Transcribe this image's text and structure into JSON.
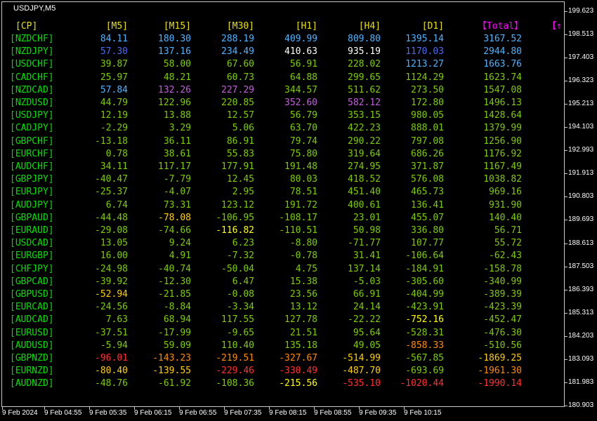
{
  "chart": {
    "symbol": "USDJPY,M5"
  },
  "colors": {
    "header": "#e8e000",
    "total_header": "#ff00ff",
    "pair": "#00e000"
  },
  "table": {
    "headers": [
      "[CP]",
      "[M5]",
      "[M15]",
      "[M30]",
      "[H1]",
      "[H4]",
      "[D1]",
      "【Total】",
      "【↑"
    ],
    "rows": [
      {
        "pair": "[NZDCHF]",
        "values": [
          "84.11",
          "180.30",
          "288.19",
          "409.99",
          "809.80",
          "1395.14",
          "3167.52"
        ],
        "colors": [
          "#4fb4ff",
          "#4fb4ff",
          "#4fb4ff",
          "#4fb4ff",
          "#4fb4ff",
          "#4fb4ff",
          "#4fb4ff"
        ]
      },
      {
        "pair": "[NZDJPY]",
        "values": [
          "57.30",
          "137.16",
          "234.49",
          "410.63",
          "935.19",
          "1170.03",
          "2944.80"
        ],
        "colors": [
          "#4a6cf0",
          "#4fb4ff",
          "#4fb4ff",
          "#ffffff",
          "#ffffff",
          "#4a6cf0",
          "#4fb4ff"
        ]
      },
      {
        "pair": "[USDCHF]",
        "values": [
          "39.87",
          "58.00",
          "67.60",
          "56.91",
          "228.02",
          "1213.27",
          "1663.76"
        ],
        "colors": [
          "#7fcc00",
          "#7fcc00",
          "#7fcc00",
          "#7fcc00",
          "#7fcc00",
          "#4fb4ff",
          "#4fb4ff"
        ]
      },
      {
        "pair": "[CADCHF]",
        "values": [
          "25.97",
          "48.21",
          "60.73",
          "64.88",
          "299.65",
          "1124.29",
          "1623.74"
        ],
        "colors": [
          "#7fcc00",
          "#7fcc00",
          "#7fcc00",
          "#7fcc00",
          "#7fcc00",
          "#7fcc00",
          "#7fcc00"
        ]
      },
      {
        "pair": "[NZDCAD]",
        "values": [
          "57.84",
          "132.26",
          "227.29",
          "344.57",
          "511.62",
          "273.50",
          "1547.08"
        ],
        "colors": [
          "#4fb4ff",
          "#c060d8",
          "#c060d8",
          "#7fcc00",
          "#7fcc00",
          "#7fcc00",
          "#7fcc00"
        ]
      },
      {
        "pair": "[NZDUSD]",
        "values": [
          "44.79",
          "122.96",
          "220.85",
          "352.60",
          "582.12",
          "172.80",
          "1496.13"
        ],
        "colors": [
          "#7fcc00",
          "#7fcc00",
          "#7fcc00",
          "#c060d8",
          "#c060d8",
          "#7fcc00",
          "#7fcc00"
        ]
      },
      {
        "pair": "[USDJPY]",
        "values": [
          "12.19",
          "13.88",
          "12.57",
          "56.79",
          "353.15",
          "980.05",
          "1428.64"
        ],
        "colors": [
          "#7fcc00",
          "#7fcc00",
          "#7fcc00",
          "#7fcc00",
          "#7fcc00",
          "#7fcc00",
          "#7fcc00"
        ]
      },
      {
        "pair": "[CADJPY]",
        "values": [
          "-2.29",
          "3.29",
          "5.06",
          "63.70",
          "422.23",
          "888.01",
          "1379.99"
        ],
        "colors": [
          "#7fcc00",
          "#7fcc00",
          "#7fcc00",
          "#7fcc00",
          "#7fcc00",
          "#7fcc00",
          "#7fcc00"
        ]
      },
      {
        "pair": "[GBPCHF]",
        "values": [
          "-13.18",
          "36.11",
          "86.91",
          "79.74",
          "290.22",
          "797.08",
          "1256.90"
        ],
        "colors": [
          "#7fcc00",
          "#7fcc00",
          "#7fcc00",
          "#7fcc00",
          "#7fcc00",
          "#7fcc00",
          "#7fcc00"
        ]
      },
      {
        "pair": "[EURCHF]",
        "values": [
          "0.78",
          "38.61",
          "55.83",
          "75.80",
          "319.64",
          "686.26",
          "1176.92"
        ],
        "colors": [
          "#7fcc00",
          "#7fcc00",
          "#7fcc00",
          "#7fcc00",
          "#7fcc00",
          "#7fcc00",
          "#7fcc00"
        ]
      },
      {
        "pair": "[AUDCHF]",
        "values": [
          "34.11",
          "117.17",
          "177.91",
          "191.48",
          "274.95",
          "371.87",
          "1167.49"
        ],
        "colors": [
          "#7fcc00",
          "#7fcc00",
          "#7fcc00",
          "#7fcc00",
          "#7fcc00",
          "#7fcc00",
          "#7fcc00"
        ]
      },
      {
        "pair": "[GBPJPY]",
        "values": [
          "-40.47",
          "-7.79",
          "12.45",
          "80.03",
          "418.52",
          "576.08",
          "1038.82"
        ],
        "colors": [
          "#7fcc00",
          "#7fcc00",
          "#7fcc00",
          "#7fcc00",
          "#7fcc00",
          "#7fcc00",
          "#7fcc00"
        ]
      },
      {
        "pair": "[EURJPY]",
        "values": [
          "-25.37",
          "-4.07",
          "2.95",
          "78.51",
          "451.40",
          "465.73",
          "969.16"
        ],
        "colors": [
          "#7fcc00",
          "#7fcc00",
          "#7fcc00",
          "#7fcc00",
          "#7fcc00",
          "#7fcc00",
          "#7fcc00"
        ]
      },
      {
        "pair": "[AUDJPY]",
        "values": [
          "6.74",
          "73.31",
          "123.12",
          "191.72",
          "400.61",
          "136.41",
          "931.90"
        ],
        "colors": [
          "#7fcc00",
          "#7fcc00",
          "#7fcc00",
          "#7fcc00",
          "#7fcc00",
          "#7fcc00",
          "#7fcc00"
        ]
      },
      {
        "pair": "[GBPAUD]",
        "values": [
          "-44.48",
          "-78.08",
          "-106.95",
          "-108.17",
          "23.01",
          "455.07",
          "140.40"
        ],
        "colors": [
          "#7fcc00",
          "#ffd000",
          "#7fcc00",
          "#7fcc00",
          "#7fcc00",
          "#7fcc00",
          "#7fcc00"
        ]
      },
      {
        "pair": "[EURAUD]",
        "values": [
          "-29.08",
          "-74.66",
          "-116.82",
          "-110.51",
          "50.98",
          "336.80",
          "56.71"
        ],
        "colors": [
          "#7fcc00",
          "#7fcc00",
          "#ffff00",
          "#7fcc00",
          "#7fcc00",
          "#7fcc00",
          "#7fcc00"
        ]
      },
      {
        "pair": "[USDCAD]",
        "values": [
          "13.05",
          "9.24",
          "6.23",
          "-8.80",
          "-71.77",
          "107.77",
          "55.72"
        ],
        "colors": [
          "#7fcc00",
          "#7fcc00",
          "#7fcc00",
          "#7fcc00",
          "#7fcc00",
          "#7fcc00",
          "#7fcc00"
        ]
      },
      {
        "pair": "[EURGBP]",
        "values": [
          "16.00",
          "4.91",
          "-7.32",
          "-0.78",
          "31.41",
          "-106.64",
          "-62.43"
        ],
        "colors": [
          "#7fcc00",
          "#7fcc00",
          "#7fcc00",
          "#7fcc00",
          "#7fcc00",
          "#7fcc00",
          "#7fcc00"
        ]
      },
      {
        "pair": "[CHFJPY]",
        "values": [
          "-24.98",
          "-40.74",
          "-50.04",
          "4.75",
          "137.14",
          "-184.91",
          "-158.78"
        ],
        "colors": [
          "#7fcc00",
          "#7fcc00",
          "#7fcc00",
          "#7fcc00",
          "#7fcc00",
          "#7fcc00",
          "#7fcc00"
        ]
      },
      {
        "pair": "[GBPCAD]",
        "values": [
          "-39.92",
          "-12.30",
          "6.47",
          "15.38",
          "-5.03",
          "-305.60",
          "-340.99"
        ],
        "colors": [
          "#7fcc00",
          "#7fcc00",
          "#7fcc00",
          "#7fcc00",
          "#7fcc00",
          "#7fcc00",
          "#7fcc00"
        ]
      },
      {
        "pair": "[GBPUSD]",
        "values": [
          "-52.94",
          "-21.85",
          "-0.08",
          "23.56",
          "66.91",
          "-404.99",
          "-389.39"
        ],
        "colors": [
          "#ffd000",
          "#7fcc00",
          "#7fcc00",
          "#7fcc00",
          "#7fcc00",
          "#7fcc00",
          "#7fcc00"
        ]
      },
      {
        "pair": "[EURCAD]",
        "values": [
          "-24.56",
          "-8.84",
          "-3.34",
          "13.12",
          "24.14",
          "-423.91",
          "-423.39"
        ],
        "colors": [
          "#7fcc00",
          "#7fcc00",
          "#7fcc00",
          "#7fcc00",
          "#7fcc00",
          "#7fcc00",
          "#7fcc00"
        ]
      },
      {
        "pair": "[AUDCAD]",
        "values": [
          "7.63",
          "68.94",
          "117.55",
          "127.78",
          "-22.22",
          "-752.16",
          "-452.47"
        ],
        "colors": [
          "#7fcc00",
          "#7fcc00",
          "#7fcc00",
          "#7fcc00",
          "#7fcc00",
          "#ffff00",
          "#7fcc00"
        ]
      },
      {
        "pair": "[EURUSD]",
        "values": [
          "-37.51",
          "-17.99",
          "-9.65",
          "21.51",
          "95.64",
          "-528.31",
          "-476.30"
        ],
        "colors": [
          "#7fcc00",
          "#7fcc00",
          "#7fcc00",
          "#7fcc00",
          "#7fcc00",
          "#7fcc00",
          "#7fcc00"
        ]
      },
      {
        "pair": "[AUDUSD]",
        "values": [
          "-5.94",
          "59.09",
          "110.40",
          "135.18",
          "49.05",
          "-858.33",
          "-510.56"
        ],
        "colors": [
          "#7fcc00",
          "#7fcc00",
          "#7fcc00",
          "#7fcc00",
          "#7fcc00",
          "#ff8c00",
          "#7fcc00"
        ]
      },
      {
        "pair": "[GBPNZD]",
        "values": [
          "-96.01",
          "-143.23",
          "-219.51",
          "-327.67",
          "-514.99",
          "-567.85",
          "-1869.25"
        ],
        "colors": [
          "#ff3030",
          "#ff8c00",
          "#ff8c00",
          "#ff8c00",
          "#ffd000",
          "#7fcc00",
          "#ffd000"
        ]
      },
      {
        "pair": "[EURNZD]",
        "values": [
          "-80.40",
          "-139.55",
          "-229.46",
          "-330.49",
          "-487.70",
          "-693.69",
          "-1961.30"
        ],
        "colors": [
          "#ffd000",
          "#ffd000",
          "#ff3030",
          "#ff3030",
          "#ffd000",
          "#7fcc00",
          "#ff8c00"
        ]
      },
      {
        "pair": "[AUDNZD]",
        "values": [
          "-48.76",
          "-61.92",
          "-108.36",
          "-215.56",
          "-535.10",
          "-1020.44",
          "-1990.14"
        ],
        "colors": [
          "#7fcc00",
          "#7fcc00",
          "#7fcc00",
          "#ffff00",
          "#ff3030",
          "#ff3030",
          "#ff3030"
        ]
      }
    ]
  },
  "price_axis": [
    "199.623",
    "198.513",
    "197.403",
    "196.323",
    "195.213",
    "194.103",
    "192.993",
    "191.913",
    "190.803",
    "189.693",
    "188.613",
    "187.503",
    "186.393",
    "185.313",
    "184.203",
    "183.093",
    "181.983",
    "180.903"
  ],
  "time_axis": [
    "9 Feb 2024",
    "9 Feb 04:55",
    "9 Feb 05:35",
    "9 Feb 06:15",
    "9 Feb 06:55",
    "9 Feb 07:35",
    "9 Feb 08:15",
    "9 Feb 08:55",
    "9 Feb 09:35",
    "9 Feb 10:15"
  ]
}
